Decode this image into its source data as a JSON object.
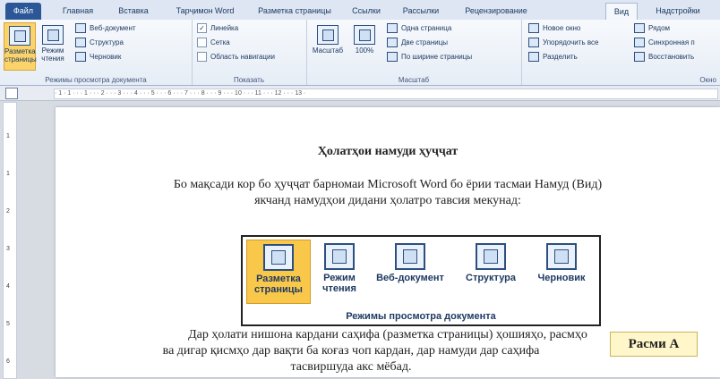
{
  "tabs": [
    "Файл",
    "Главная",
    "Вставка",
    "Тарҷимон Word",
    "Разметка страницы",
    "Ссылки",
    "Рассылки",
    "Рецензирование",
    "Вид",
    "Надстройки"
  ],
  "ribbon": {
    "views_group": {
      "buttons": [
        "Разметка страницы",
        "Режим чтения"
      ],
      "small": [
        "Веб-документ",
        "Структура",
        "Черновик"
      ],
      "label": "Режимы просмотра документа"
    },
    "show_group": {
      "items": [
        {
          "label": "Линейка",
          "checked": true
        },
        {
          "label": "Сетка",
          "checked": false
        },
        {
          "label": "Область навигации",
          "checked": false
        }
      ],
      "label": "Показать"
    },
    "zoom_group": {
      "buttons": [
        "Масштаб",
        "100%"
      ],
      "small": [
        "Одна страница",
        "Две страницы",
        "По ширине страницы"
      ],
      "label": "Масштаб"
    },
    "window_group": {
      "small": [
        "Новое окно",
        "Упорядочить все",
        "Разделить"
      ],
      "small2": [
        "Рядом",
        "Синхронная п",
        "Восстановить"
      ],
      "label": "Окно"
    }
  },
  "ruler": {
    "text": "· 1 · 1 · · · 1 · · · 2 · · · 3 · · · 4 · · · 5 · · · 6 · · · 7 · · · 8 · · · 9 · · · 10 · · · 11 · · · 12 · · · 13 ·"
  },
  "vruler": [
    "1",
    "1",
    "2",
    "3",
    "4",
    "5",
    "6"
  ],
  "document": {
    "title": "Ҳолатҳои намуди ҳуҷҷат",
    "para1_line1": "Бо  мақсади кор бо ҳуҷҷат барномаи Microsoft Word бо ёрии тасмаи Намуд (Вид)",
    "para1_line2": "якчанд намудҳои дидани ҳолатро тавсия мекунад:",
    "figure": {
      "buttons": [
        "Разметка страницы",
        "Режим чтения",
        "Веб-документ",
        "Структура",
        "Черновик"
      ],
      "caption": "Режимы просмотра документа"
    },
    "para2_line1": "Дар ҳолати нишона кардани саҳифа (разметка страницы) ҳошияҳо, расмҳо",
    "para2_line2": "ва дигар қисмҳо дар вақти ба коғаз чоп кардан, дар намуди дар саҳифа",
    "para2_line3": "тасвиршуда акс мёбад.",
    "figure_label": "Расми А"
  }
}
